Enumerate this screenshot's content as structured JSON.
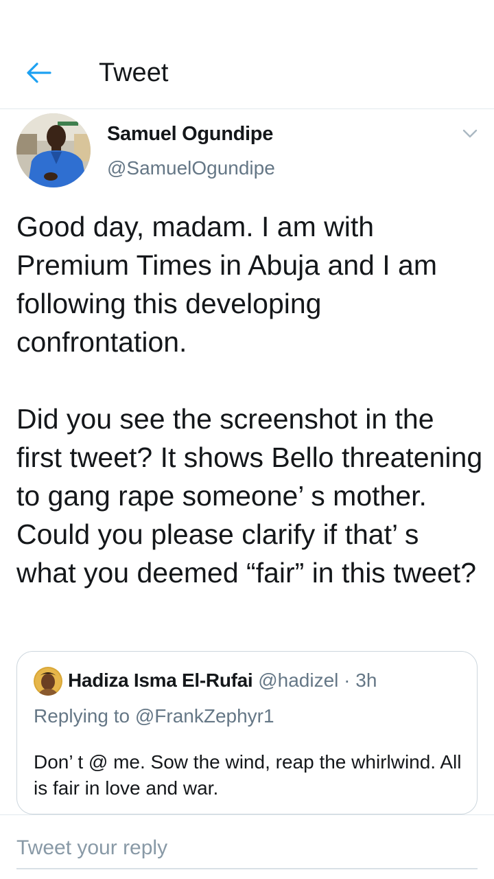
{
  "header": {
    "title": "Tweet",
    "back_icon": "arrow-left-icon",
    "accent_color": "#1da1f2"
  },
  "tweet": {
    "author_name": "Samuel Ogundipe",
    "author_handle": "@SamuelOgundipe",
    "menu_icon": "chevron-down-icon",
    "text": "Good day, madam. I am with Premium Times in Abuja and I am following this developing confrontation.\n\nDid you see the screenshot in the first tweet? It shows Bello threatening to gang rape someone’ s mother. Could you please clarify if that’ s what you deemed “fair” in this tweet?"
  },
  "quoted_tweet": {
    "author_name": "Hadiza Isma El-Rufai",
    "author_handle": "@hadizel",
    "separator": "·",
    "time": "3h",
    "replying_to": "Replying to @FrankZephyr1",
    "text": "Don’ t @ me. Sow the wind, reap the whirlwind. All is fair in love and war."
  },
  "reply": {
    "placeholder": "Tweet your reply"
  }
}
